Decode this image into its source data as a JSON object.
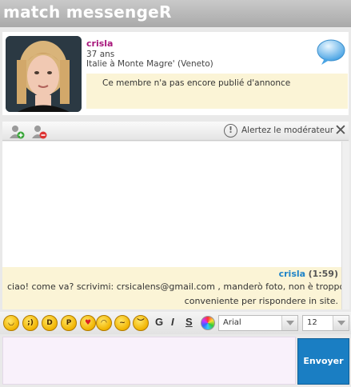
{
  "app": {
    "title": "match messengeR"
  },
  "profile": {
    "name": "crisla",
    "age": "37 ans",
    "location": "Italie à Monte Magre' (Veneto)",
    "annonce": "Ce membre n'a pas encore publié d'annonce"
  },
  "toolbar": {
    "alert_label": "Alertez le modérateur",
    "close_glyph": "✕"
  },
  "chat": {
    "messages": [
      {
        "user": "crisla",
        "time": "(1:59)",
        "line1": "ciao! come va? scrivimi: crsicalens@gmail.com , manderò foto, non è troppo",
        "line2": "conveniente per rispondere in site."
      }
    ]
  },
  "format": {
    "bold": "G",
    "italic": "I",
    "strike": "S",
    "font": "Arial",
    "size": "12",
    "emoticons": [
      "smile-icon",
      "wink-icon",
      "grin-icon",
      "tongue-icon",
      "love-icon",
      "sad-icon",
      "confused-icon",
      "unhappy-icon"
    ]
  },
  "composer": {
    "send_label": "Envoyer"
  },
  "colors": {
    "accent": "#1a7ec3",
    "name": "#a8187c",
    "highlight": "#fbf4d6"
  }
}
